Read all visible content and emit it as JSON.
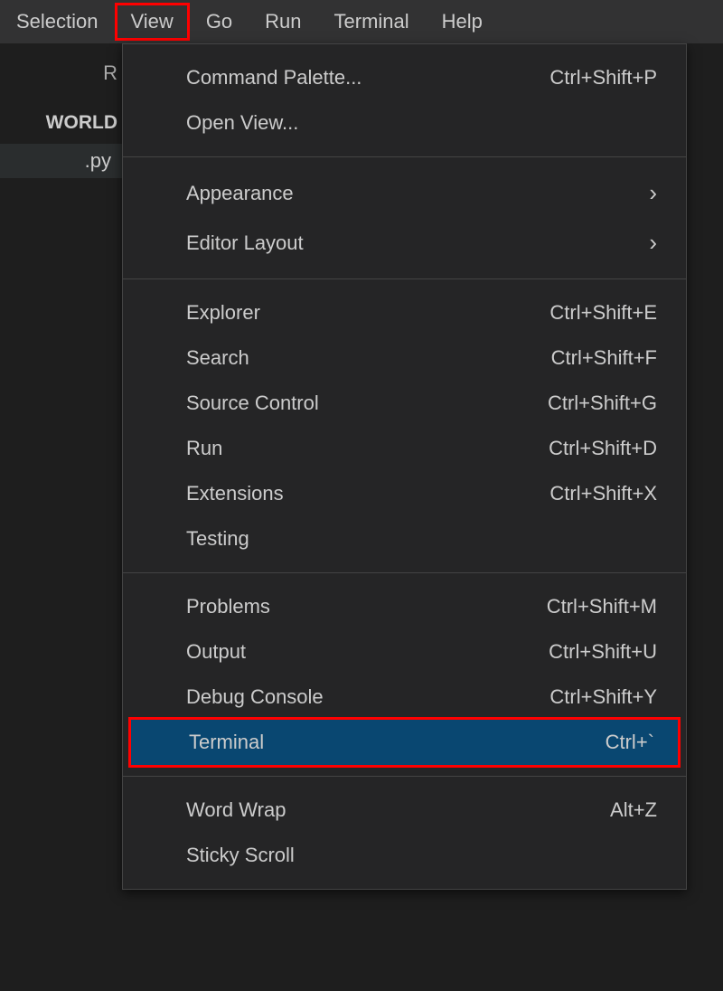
{
  "menubar": {
    "items": [
      {
        "label": "Selection"
      },
      {
        "label": "View"
      },
      {
        "label": "Go"
      },
      {
        "label": "Run"
      },
      {
        "label": "Terminal"
      },
      {
        "label": "Help"
      }
    ],
    "activeIndex": 1
  },
  "sidebar": {
    "explorerFragment": "R",
    "folderFragment": "WORLD",
    "fileFragment": ".py"
  },
  "dropdown": {
    "groups": [
      [
        {
          "label": "Command Palette...",
          "shortcut": "Ctrl+Shift+P"
        },
        {
          "label": "Open View...",
          "shortcut": ""
        }
      ],
      [
        {
          "label": "Appearance",
          "submenu": true
        },
        {
          "label": "Editor Layout",
          "submenu": true
        }
      ],
      [
        {
          "label": "Explorer",
          "shortcut": "Ctrl+Shift+E"
        },
        {
          "label": "Search",
          "shortcut": "Ctrl+Shift+F"
        },
        {
          "label": "Source Control",
          "shortcut": "Ctrl+Shift+G"
        },
        {
          "label": "Run",
          "shortcut": "Ctrl+Shift+D"
        },
        {
          "label": "Extensions",
          "shortcut": "Ctrl+Shift+X"
        },
        {
          "label": "Testing",
          "shortcut": ""
        }
      ],
      [
        {
          "label": "Problems",
          "shortcut": "Ctrl+Shift+M"
        },
        {
          "label": "Output",
          "shortcut": "Ctrl+Shift+U"
        },
        {
          "label": "Debug Console",
          "shortcut": "Ctrl+Shift+Y"
        },
        {
          "label": "Terminal",
          "shortcut": "Ctrl+`",
          "highlighted": true
        }
      ],
      [
        {
          "label": "Word Wrap",
          "shortcut": "Alt+Z"
        },
        {
          "label": "Sticky Scroll",
          "shortcut": ""
        }
      ]
    ]
  },
  "chevron": "›"
}
